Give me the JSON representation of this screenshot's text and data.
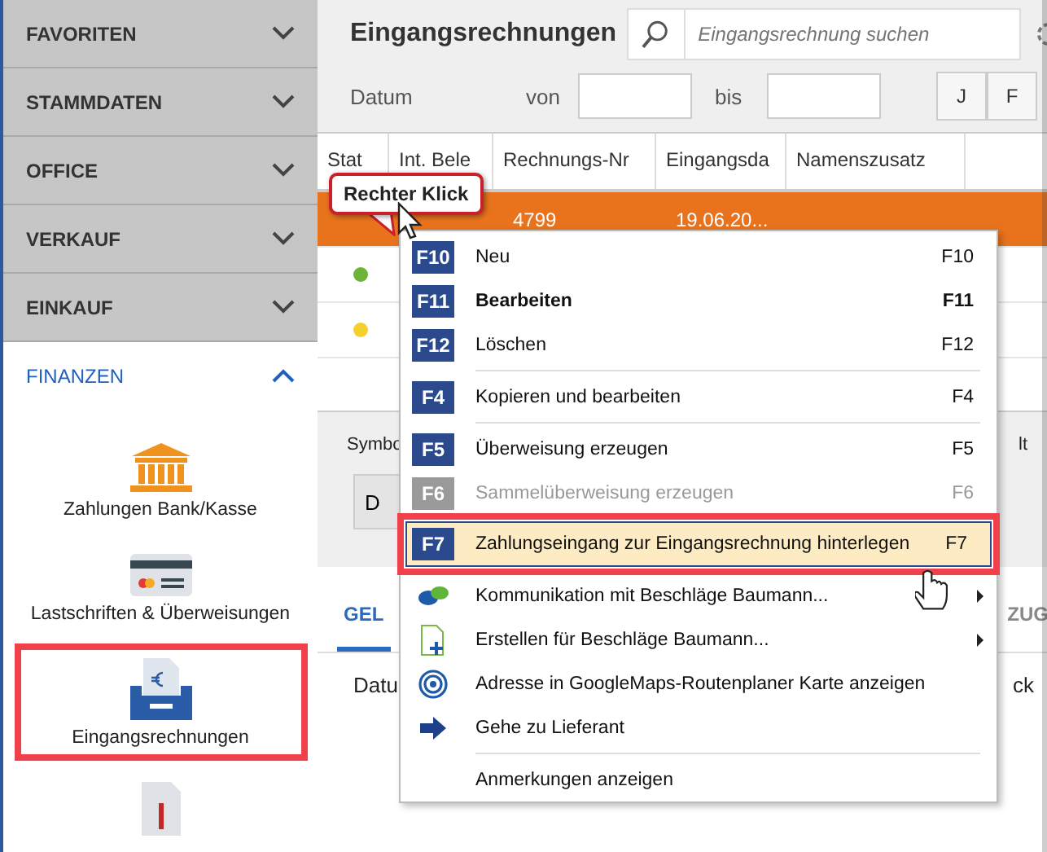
{
  "sidebar": {
    "sections": [
      {
        "label": "FAVORITEN",
        "expanded": false
      },
      {
        "label": "STAMMDATEN",
        "expanded": false
      },
      {
        "label": "OFFICE",
        "expanded": false
      },
      {
        "label": "VERKAUF",
        "expanded": false
      },
      {
        "label": "EINKAUF",
        "expanded": false
      },
      {
        "label": "FINANZEN",
        "expanded": true
      }
    ],
    "items": [
      {
        "kind": "bank",
        "label": "Zahlungen Bank/Kasse",
        "highlighted": false
      },
      {
        "kind": "card",
        "label": "Lastschriften & Überweisungen",
        "highlighted": false
      },
      {
        "kind": "tray",
        "label": "Eingangsrechnungen",
        "highlighted": true
      },
      {
        "kind": "document",
        "highlighted": false
      }
    ]
  },
  "header": {
    "title": "Eingangsrechnungen",
    "search": {
      "placeholder": "Eingangsrechnung suchen"
    },
    "date_label": "Datum",
    "from_label": "von",
    "to_label": "bis",
    "months": [
      "J",
      "F"
    ]
  },
  "table": {
    "columns": [
      "Stat",
      "Int. Bele",
      "Rechnungs-Nr",
      "Eingangsda",
      "Namenszusatz"
    ],
    "rows": [
      {
        "selected": true,
        "cells": [
          "",
          "",
          "4799",
          "19.06.20...",
          ""
        ]
      },
      {
        "selected": false,
        "color": "#6cb33a",
        "cells": [
          "",
          "",
          "",
          "",
          ""
        ]
      },
      {
        "selected": false,
        "color": "#f5cf2e",
        "cells": [
          "",
          "",
          "",
          "",
          ""
        ]
      }
    ]
  },
  "lower": {
    "symbol_label": "Symbo",
    "right_label": "lt",
    "button": "D",
    "tabs": [
      {
        "label": "GEL",
        "selected": true
      },
      {
        "label": "ZUG",
        "selected": false
      }
    ],
    "columns": [
      "Datu",
      "ck"
    ]
  },
  "callout": "Rechter Klick",
  "context_menu": [
    {
      "kind": "hotkey",
      "key": "F10",
      "label": "Neu",
      "shortcut": "F10",
      "bold": false,
      "disabled": false,
      "highlighted": false
    },
    {
      "kind": "hotkey",
      "key": "F11",
      "label": "Bearbeiten",
      "shortcut": "F11",
      "bold": true,
      "disabled": false,
      "highlighted": false
    },
    {
      "kind": "hotkey",
      "key": "F12",
      "label": "Löschen",
      "shortcut": "F12",
      "bold": false,
      "disabled": false,
      "highlighted": false
    },
    {
      "kind": "separator"
    },
    {
      "kind": "hotkey",
      "key": "F4",
      "label": "Kopieren und bearbeiten",
      "shortcut": "F4",
      "bold": false,
      "disabled": false,
      "highlighted": false
    },
    {
      "kind": "separator"
    },
    {
      "kind": "hotkey",
      "key": "F5",
      "label": "Überweisung erzeugen",
      "shortcut": "F5",
      "bold": false,
      "disabled": false,
      "highlighted": false
    },
    {
      "kind": "hotkey",
      "key": "F6",
      "label": "Sammelüberweisung erzeugen",
      "shortcut": "F6",
      "bold": false,
      "disabled": true,
      "highlighted": false
    },
    {
      "kind": "hotkey",
      "key": "F7",
      "label": "Zahlungseingang zur Eingangsrechnung hinterlegen",
      "shortcut": "F7",
      "bold": false,
      "disabled": false,
      "highlighted": true
    },
    {
      "kind": "chat",
      "label": "Kommunikation mit Beschläge Baumann...",
      "submenu": true
    },
    {
      "kind": "document",
      "label": "Erstellen für Beschläge Baumann...",
      "submenu": true
    },
    {
      "kind": "target",
      "label": "Adresse in GoogleMaps-Routenplaner Karte anzeigen",
      "submenu": false
    },
    {
      "kind": "arrow",
      "label": "Gehe zu Lieferant",
      "submenu": false
    },
    {
      "kind": "separator"
    },
    {
      "kind": "plain",
      "label": "Anmerkungen anzeigen",
      "submenu": false
    }
  ]
}
